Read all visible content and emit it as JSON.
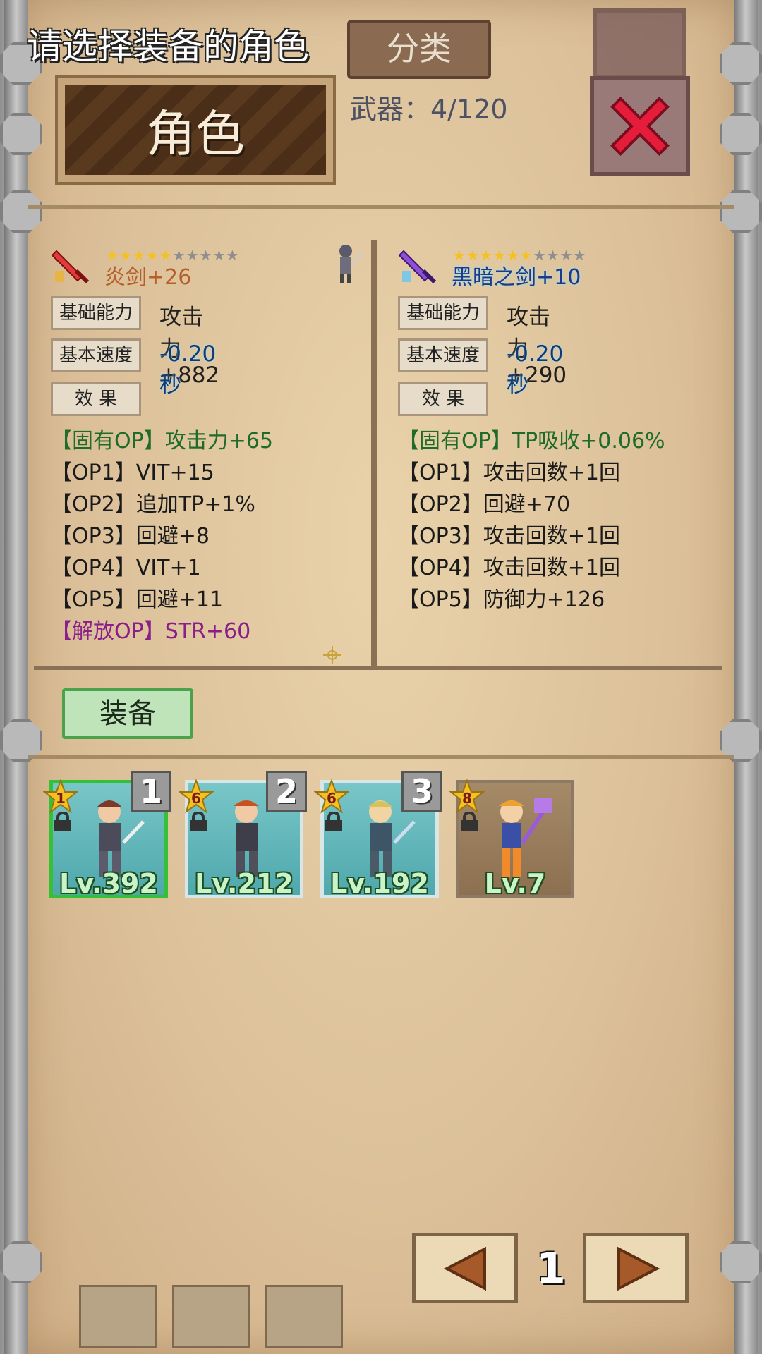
{
  "header": {
    "prompt_title": "请选择装备的角色",
    "section_title": "角色",
    "category_label": "分类",
    "weapon_count": "武器：4/120"
  },
  "colors": {
    "close_red": "#e51d3a",
    "equip_green": "#4aa34a",
    "op_green": "#1f6b2a",
    "op_purple": "#8b1f8a"
  },
  "left_item": {
    "name": "炎剑+26",
    "icon": "red-sword-icon",
    "stars_on": 5,
    "stars_total": 10,
    "base_label": "基础能力",
    "base_value": "攻击力+882",
    "speed_label": "基本速度",
    "speed_value": "-0.20秒",
    "effect_label": "效 果",
    "ops": [
      "【固有OP】攻击力+65",
      "【OP1】VIT+15",
      "【OP2】追加TP+1%",
      "【OP3】回避+8",
      "【OP4】VIT+1",
      "【OP5】回避+11",
      "【解放OP】STR+60"
    ]
  },
  "right_item": {
    "name": "黑暗之剑+10",
    "icon": "purple-sword-icon",
    "stars_on": 6,
    "stars_total": 10,
    "base_label": "基础能力",
    "base_value": "攻击力+290",
    "speed_label": "基本速度",
    "speed_value": "-0.20秒",
    "effect_label": "效 果",
    "ops": [
      "【固有OP】TP吸收+0.06%",
      "【OP1】攻击回数+1回",
      "【OP2】回避+70",
      "【OP3】攻击回数+1回",
      "【OP4】攻击回数+1回",
      "【OP5】防御力+126"
    ]
  },
  "equip_button": "装备",
  "characters": [
    {
      "star": "1",
      "rank": "1",
      "level": "Lv.392"
    },
    {
      "star": "6",
      "rank": "2",
      "level": "Lv.212"
    },
    {
      "star": "6",
      "rank": "3",
      "level": "Lv.192"
    },
    {
      "star": "8",
      "rank": "",
      "level": "Lv.7"
    }
  ],
  "pagination": {
    "page": "1"
  }
}
